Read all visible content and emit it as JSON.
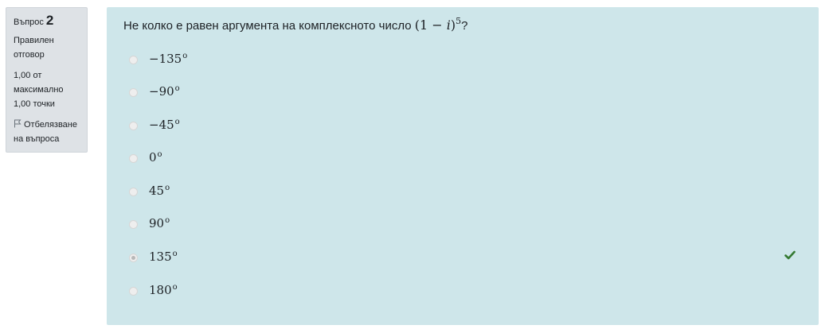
{
  "info": {
    "question_label": "Въпрос",
    "question_number": "2",
    "state": "Правилен отговор",
    "grade": "1,00 от максимално 1,00 точки",
    "flag_label": "Отбелязване на въпроса",
    "flag_icon": "flag-outline-icon"
  },
  "question": {
    "text": "Не колко е равен аргумента на комплексното число",
    "formula_open": "(1 − ",
    "formula_var": "i",
    "formula_close": ")",
    "formula_power": "5",
    "suffix": "?"
  },
  "answers": [
    {
      "value": "−135",
      "degree": "o",
      "selected": false
    },
    {
      "value": "−90",
      "degree": "o",
      "selected": false
    },
    {
      "value": "−45",
      "degree": "o",
      "selected": false
    },
    {
      "value": "0",
      "degree": "o",
      "selected": false
    },
    {
      "value": "45",
      "degree": "o",
      "selected": false
    },
    {
      "value": "90",
      "degree": "o",
      "selected": false
    },
    {
      "value": "135",
      "degree": "o",
      "selected": true
    },
    {
      "value": "180",
      "degree": "o",
      "selected": false
    }
  ],
  "feedback": {
    "correct_icon": "checkmark-icon",
    "correct_color": "#357a32"
  },
  "colors": {
    "content_bg": "#cee6ea",
    "info_bg": "#dee2e6"
  }
}
